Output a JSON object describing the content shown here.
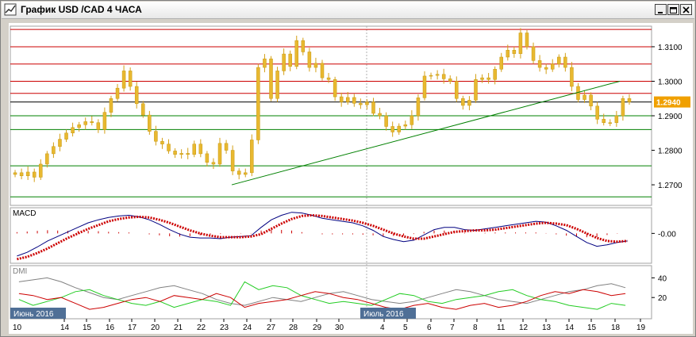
{
  "window": {
    "title": "График USD /CAD  4 ЧАСА"
  },
  "chart_data": [
    {
      "type": "candlestick",
      "title": "",
      "price_label": "1.2940",
      "y_ticks": [
        "1.3100",
        "1.3000",
        "1.2900",
        "1.2800",
        "1.2700"
      ],
      "y_tick_values": [
        1.31,
        1.3,
        1.29,
        1.28,
        1.27
      ],
      "ylim": [
        1.2645,
        1.3155
      ],
      "current_price": 1.294,
      "horizontal_levels": {
        "red": [
          1.315,
          1.31,
          1.305,
          1.3,
          1.2965
        ],
        "black": [
          1.294
        ],
        "green": [
          1.29,
          1.286,
          1.2755,
          1.2665
        ]
      },
      "trendline": {
        "from": [
          "23",
          1.27
        ],
        "to": [
          "18",
          1.3
        ]
      },
      "close_series": [
        1.2735,
        1.2726,
        1.2737,
        1.2722,
        1.276,
        1.279,
        1.2811,
        1.2832,
        1.285,
        1.2866,
        1.2874,
        1.2883,
        1.288,
        1.286,
        1.291,
        1.295,
        1.298,
        1.303,
        1.2985,
        1.2935,
        1.2902,
        1.2855,
        1.2826,
        1.2818,
        1.2798,
        1.2788,
        1.2791,
        1.2788,
        1.2818,
        1.279,
        1.2765,
        1.276,
        1.282,
        1.28,
        1.274,
        1.273,
        1.2735,
        1.283,
        1.304,
        1.3065,
        1.295,
        1.303,
        1.3079,
        1.3043,
        1.3118,
        1.3085,
        1.304,
        1.3052,
        1.301,
        1.3005,
        1.2955,
        1.294,
        1.2953,
        1.2936,
        1.2932,
        1.294,
        1.2907,
        1.29,
        1.2869,
        1.2853,
        1.287,
        1.2874,
        1.29,
        1.2952,
        1.3015,
        1.3017,
        1.302,
        1.3007,
        1.3,
        1.295,
        1.293,
        1.2945,
        1.3005,
        1.301,
        1.3005,
        1.3035,
        1.307,
        1.309,
        1.308,
        1.314,
        1.31,
        1.306,
        1.304,
        1.3035,
        1.305,
        1.307,
        1.304,
        1.2985,
        1.2947,
        1.296,
        1.2928,
        1.289,
        1.288,
        1.288,
        1.29,
        1.295,
        1.294
      ]
    },
    {
      "type": "line",
      "title": "MACD",
      "y_ticks": [
        "-0.00"
      ],
      "series": [
        {
          "name": "",
          "color": "#000080",
          "values": [
            -0.003,
            -0.0025,
            -0.0018,
            -0.001,
            -0.0004,
            0.0002,
            0.0008,
            0.0014,
            0.0018,
            0.0021,
            0.0023,
            0.0024,
            0.0022,
            0.0018,
            0.0012,
            0.0005,
            -0.0001,
            -0.0005,
            -0.0006,
            -0.0006,
            -0.0007,
            -0.0005,
            -0.0004,
            -0.0003,
            0.0008,
            0.0018,
            0.0024,
            0.0028,
            0.0027,
            0.0024,
            0.002,
            0.0018,
            0.0016,
            0.0014,
            0.001,
            0.0004,
            -0.0004,
            -0.0008,
            -0.0011,
            -0.0009,
            -0.0002,
            0.0005,
            0.0008,
            0.0008,
            0.0005,
            0.0004,
            0.0006,
            0.0008,
            0.001,
            0.0012,
            0.0014,
            0.0016,
            0.0015,
            0.001,
            0.0004,
            -0.0004,
            -0.0012,
            -0.0017,
            -0.0015,
            -0.0012,
            -0.001
          ]
        },
        {
          "name": "",
          "color": "#cc0000",
          "values": [
            -0.0034,
            -0.0031,
            -0.0026,
            -0.002,
            -0.0013,
            -0.0006,
            0.0,
            0.0006,
            0.0011,
            0.0016,
            0.0019,
            0.0021,
            0.0022,
            0.0021,
            0.0018,
            0.0014,
            0.0009,
            0.0004,
            0.0,
            -0.0003,
            -0.0005,
            -0.0005,
            -0.0005,
            -0.0004,
            -0.0001,
            0.0006,
            0.0013,
            0.0019,
            0.0023,
            0.0024,
            0.0023,
            0.0021,
            0.0019,
            0.0017,
            0.0014,
            0.001,
            0.0005,
            0.0,
            -0.0004,
            -0.0007,
            -0.0007,
            -0.0004,
            -0.0001,
            0.0002,
            0.0003,
            0.0004,
            0.0004,
            0.0005,
            0.0007,
            0.0009,
            0.0011,
            0.0013,
            0.0014,
            0.0013,
            0.0011,
            0.0006,
            0.0,
            -0.0006,
            -0.001,
            -0.0011,
            -0.001
          ]
        }
      ]
    },
    {
      "type": "line",
      "title": "DMI",
      "y_ticks": [
        "40",
        "20"
      ],
      "ylim": [
        0,
        50
      ],
      "series": [
        {
          "name": "",
          "color": "#808080",
          "values": [
            36,
            38,
            40,
            36,
            30,
            25,
            20,
            18,
            22,
            26,
            30,
            32,
            28,
            24,
            18,
            14,
            12,
            16,
            20,
            18,
            16,
            20,
            24,
            26,
            22,
            18,
            16,
            14,
            16,
            20,
            24,
            28,
            26,
            22,
            18,
            16,
            14,
            18,
            22,
            26,
            28,
            32,
            34,
            30
          ]
        },
        {
          "name": "",
          "color": "#22cc22",
          "values": [
            18,
            12,
            16,
            20,
            26,
            28,
            22,
            18,
            14,
            12,
            16,
            10,
            14,
            18,
            16,
            12,
            36,
            28,
            32,
            30,
            22,
            18,
            14,
            16,
            14,
            12,
            18,
            24,
            22,
            16,
            14,
            18,
            20,
            22,
            26,
            28,
            22,
            18,
            16,
            12,
            10,
            8,
            14,
            12
          ]
        },
        {
          "name": "",
          "color": "#cc0000",
          "values": [
            24,
            22,
            18,
            20,
            14,
            8,
            10,
            14,
            18,
            20,
            16,
            22,
            20,
            18,
            24,
            20,
            10,
            14,
            16,
            18,
            22,
            26,
            24,
            20,
            18,
            14,
            10,
            8,
            12,
            14,
            10,
            8,
            12,
            14,
            10,
            12,
            16,
            22,
            26,
            24,
            28,
            26,
            22,
            24
          ]
        }
      ]
    }
  ],
  "x_axis": {
    "month_start": "Июнь 2016",
    "month_mid": "Июль 2016",
    "days": [
      "14",
      "15",
      "16",
      "17",
      "20",
      "21",
      "22",
      "23",
      "24",
      "27",
      "28",
      "29",
      "30",
      "4",
      "5",
      "6",
      "7",
      "8",
      "11",
      "12",
      "13",
      "14",
      "15",
      "18",
      "19"
    ],
    "first_day": "10",
    "days_after_mid": [
      "4",
      "5",
      "6",
      "7",
      "8",
      "11",
      "12",
      "13",
      "14",
      "15",
      "18",
      "19"
    ]
  }
}
